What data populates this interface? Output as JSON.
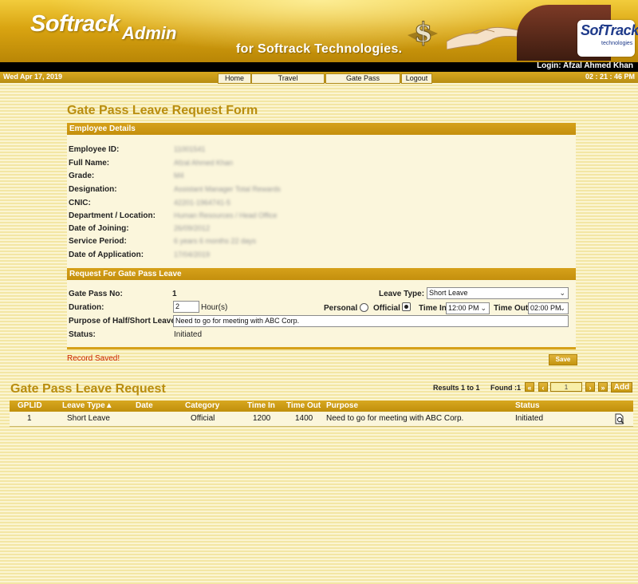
{
  "header": {
    "brand": "Softrack",
    "brand_sub": "Admin",
    "tagline": "for Softrack Technologies.",
    "logo_text": "SofTrack",
    "logo_sub": "technologies",
    "login_text": "Login: Afzal Ahmed Khan"
  },
  "navbar": {
    "date": "Wed Apr 17, 2019",
    "clock": "02 : 21 : 46 PM",
    "items": [
      "Home",
      "Travel",
      "Gate Pass",
      "Logout"
    ]
  },
  "form": {
    "title": "Gate Pass Leave Request Form",
    "employee_section": "Employee Details",
    "employee_labels": [
      "Employee ID:",
      "Full Name:",
      "Grade:",
      "Designation:",
      "CNIC:",
      "Department / Location:",
      "Date of Joining:",
      "Service Period:",
      "Date of Application:"
    ],
    "employee_values_blurred": [
      "11001541",
      "Afzal Ahmed Khan",
      "M4",
      "Assistant Manager Total Rewards",
      "42201-1964741-5",
      "Human Resources / Head Office",
      "26/09/2012",
      "6 years 6 months 22 days",
      "17/04/2019"
    ],
    "request_section": "Request For Gate Pass Leave",
    "gate_pass_no_label": "Gate Pass No:",
    "gate_pass_no": "1",
    "leave_type_label": "Leave Type:",
    "leave_type": "Short Leave",
    "duration_label": "Duration:",
    "duration": "2",
    "duration_unit": "Hour(s)",
    "personal_label": "Personal",
    "official_label": "Official",
    "time_in_label": "Time In",
    "time_in": "12:00 PM",
    "time_out_label": "Time Out",
    "time_out": "02:00 PM",
    "purpose_label": "Purpose of Half/Short Leave:",
    "purpose": "Need to go for meeting with ABC Corp.",
    "status_label": "Status:",
    "status": "Initiated",
    "record_saved": "Record Saved!",
    "save_label": "Save"
  },
  "list": {
    "title": "Gate Pass Leave Request",
    "results": "Results 1 to 1",
    "found": "Found :1",
    "page": "1",
    "add_label": "Add",
    "columns": [
      "GPLID",
      "Leave Type▲",
      "Date",
      "Category",
      "Time In",
      "Time Out",
      "Purpose",
      "Status"
    ],
    "rows": [
      [
        "1",
        "Short Leave",
        "",
        "Official",
        "1200",
        "1400",
        "Need to go for meeting with ABC Corp.",
        "Initiated"
      ]
    ]
  },
  "colors": {
    "accent": "#c8960f",
    "title": "#b98d0f",
    "error": "#cc2200"
  }
}
